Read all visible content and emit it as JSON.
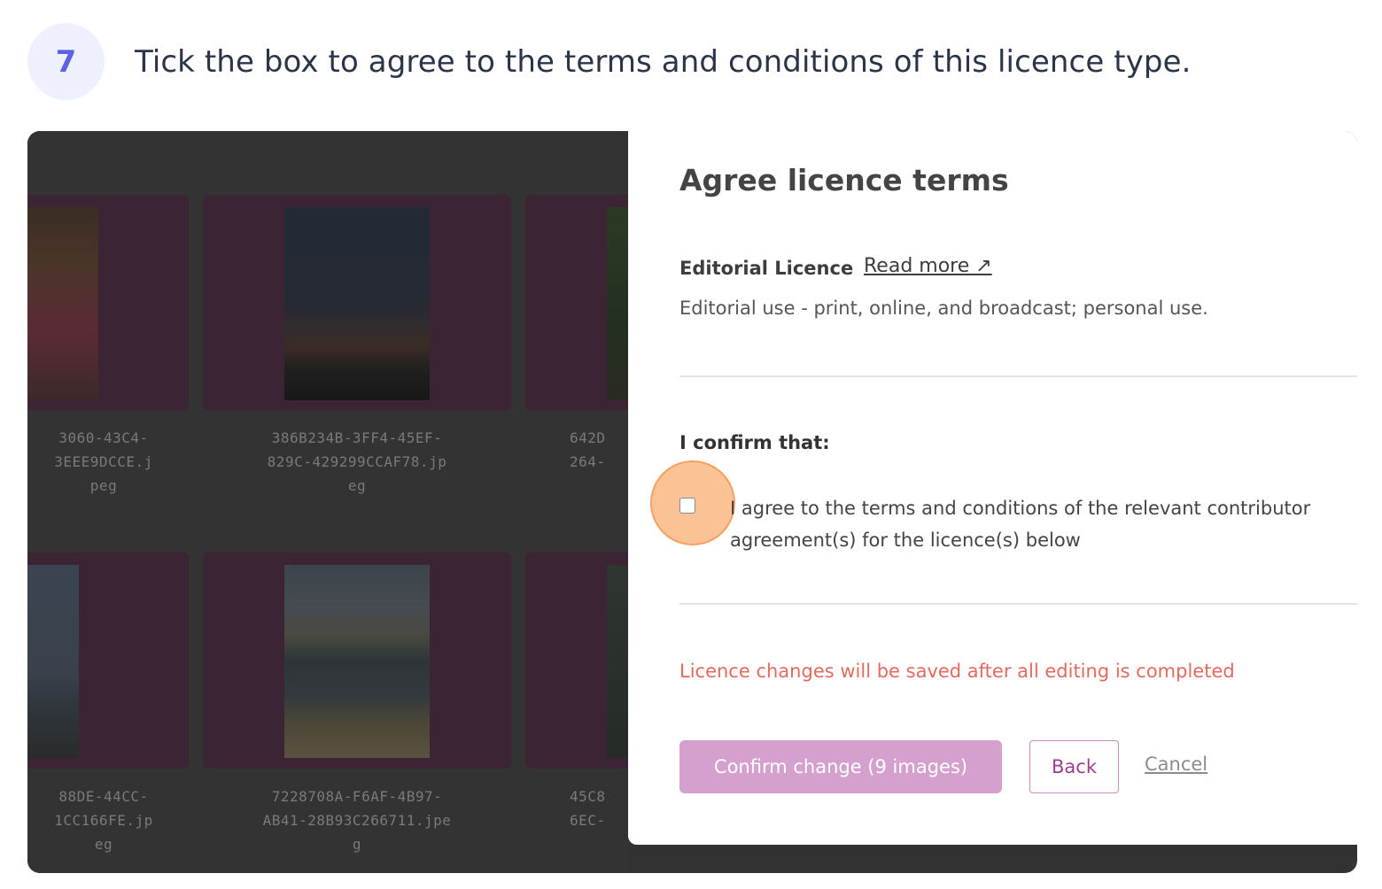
{
  "step": {
    "number": "7",
    "instruction": "Tick the box to agree to the terms and conditions of this licence type."
  },
  "grid": {
    "row1_filenames": [
      [
        "3060-43C4-",
        "3EEE9DCCE.j",
        "peg"
      ],
      [
        "386B234B-3FF4-45EF-",
        "829C-429299CCAF78.jp",
        "eg"
      ],
      [
        "642D",
        "264-"
      ]
    ],
    "row2_filenames": [
      [
        "88DE-44CC-",
        "1CC166FE.jp",
        "eg"
      ],
      [
        "7228708A-F6AF-4B97-",
        "AB41-28B93C266711.jpe",
        "g"
      ],
      [
        "45C8",
        "6EC-"
      ]
    ]
  },
  "panel": {
    "title": "Agree licence terms",
    "licence_name": "Editorial Licence",
    "read_more": "Read more ↗",
    "licence_description": "Editorial use - print, online, and broadcast; personal use.",
    "confirm_heading": "I confirm that:",
    "agree_line1": "I agree to the terms and conditions of the relevant contributor",
    "agree_line2": "agreement(s) for the licence(s) below",
    "agree_checked": false,
    "warning": "Licence changes will be saved after all editing is completed",
    "confirm_button": "Confirm change (9 images)",
    "back_button": "Back",
    "cancel_link": "Cancel"
  },
  "colors": {
    "accent": "#5b63e4",
    "brand_purple": "#9a3f90",
    "confirm_button_bg": "#d6a0ce",
    "warning": "#e46a5e",
    "highlight": "#f8a060"
  }
}
